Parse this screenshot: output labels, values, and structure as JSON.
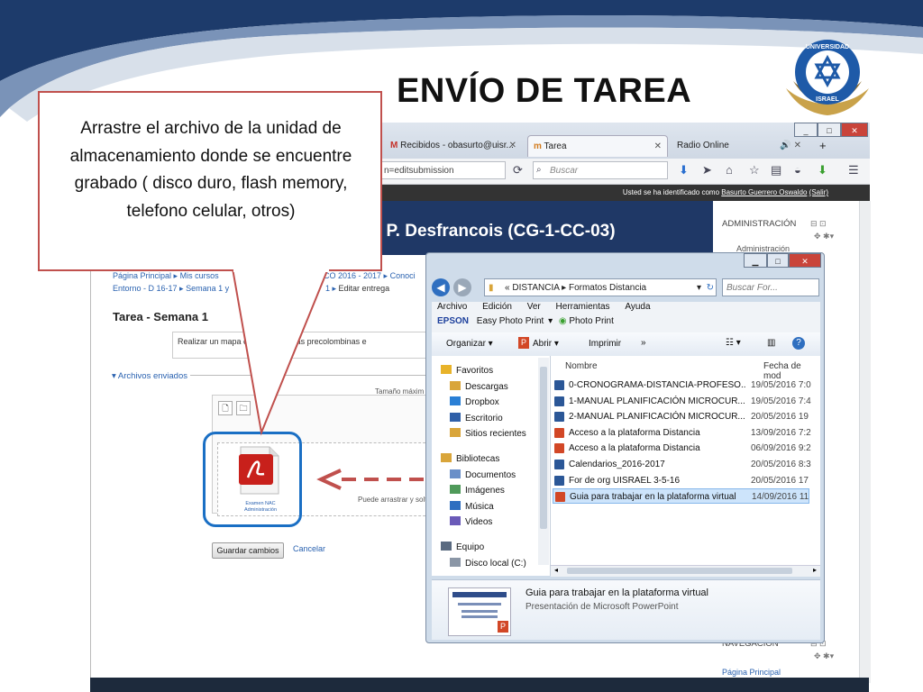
{
  "slide": {
    "title": "ENVÍO DE TAREA",
    "logo_text": "UNIVERSIDAD ISRAEL",
    "callout": "Arrastre el archivo de la unidad de almacenamiento donde se encuentre grabado ( disco duro, flash memory, telefono celular, otros)"
  },
  "browser": {
    "tabs": [
      {
        "label": "Recibidos - obasurto@uisr...",
        "icon": "gmail-icon"
      },
      {
        "label": "Tarea",
        "icon": "moodle-icon"
      },
      {
        "label": "Radio Online",
        "icon": "speaker-icon"
      }
    ],
    "new_tab": "+",
    "url": "n=editsubmission",
    "search_placeholder": "Buscar",
    "session_text": "Usted se ha identificado como",
    "user_link": "Basurto Guerrero Oswaldo",
    "logout": "(Salir)"
  },
  "moodle": {
    "course_title": "a - P. Desfrancois (CG-1-CC-03)",
    "breadcrumb": {
      "line1_a": "Página Principal",
      "line1_b": "Mis cursos",
      "line1_c": "CO 2016 - 2017",
      "line1_d": "Conoci",
      "line2_a": "Entorno - D 16-17",
      "line2_b": "Semana 1 y",
      "line2_c": "1",
      "line2_d": "Editar entrega"
    },
    "heading": "Tarea - Semana 1",
    "description": "Realizar un mapa c          bre las culturas precolombinas e",
    "files_legend": "Archivos enviados",
    "max_size": "Tamaño máxim",
    "dropzone_text": "Puede arrastrar y solt",
    "file_name": "Examen NAC Administración",
    "save_button": "Guardar cambios",
    "cancel": "Cancelar",
    "sidebar": {
      "admin_title": "ADMINISTRACIÓN",
      "admin_sub": "Administración",
      "nav_title": "NAVEGACIÓN",
      "nav_item": "Página Principal"
    }
  },
  "explorer": {
    "address_parts": [
      "«",
      "DISTANCIA",
      "Formatos Distancia"
    ],
    "search_placeholder": "Buscar For...",
    "menu": [
      "Archivo",
      "Edición",
      "Ver",
      "Herramientas",
      "Ayuda"
    ],
    "epson": {
      "brand": "EPSON",
      "easy": "Easy Photo Print",
      "photo": "Photo Print"
    },
    "toolbar": {
      "organize": "Organizar",
      "open": "Abrir",
      "print": "Imprimir",
      "more": "»"
    },
    "columns": {
      "name": "Nombre",
      "date": "Fecha de mod"
    },
    "nav": [
      {
        "label": "Favoritos",
        "icon": "star-icon",
        "top": true
      },
      {
        "label": "Descargas",
        "icon": "download-folder-icon"
      },
      {
        "label": "Dropbox",
        "icon": "dropbox-icon"
      },
      {
        "label": "Escritorio",
        "icon": "desktop-icon"
      },
      {
        "label": "Sitios recientes",
        "icon": "recent-icon"
      },
      {
        "label": "Bibliotecas",
        "icon": "library-icon",
        "top": true
      },
      {
        "label": "Documentos",
        "icon": "documents-icon"
      },
      {
        "label": "Imágenes",
        "icon": "images-icon"
      },
      {
        "label": "Música",
        "icon": "music-icon"
      },
      {
        "label": "Videos",
        "icon": "videos-icon"
      },
      {
        "label": "Equipo",
        "icon": "computer-icon",
        "top": true
      },
      {
        "label": "Disco local (C:)",
        "icon": "disk-icon"
      }
    ],
    "files": [
      {
        "name": "0-CRONOGRAMA-DISTANCIA-PROFESO...",
        "date": "19/05/2016 7:0",
        "type": "word"
      },
      {
        "name": "1-MANUAL PLANIFICACIÓN MICROCUR...",
        "date": "19/05/2016 7:4",
        "type": "word"
      },
      {
        "name": "2-MANUAL PLANIFICACIÓN MICROCUR...",
        "date": "20/05/2016 19",
        "type": "word"
      },
      {
        "name": "Acceso a la plataforma Distancia",
        "date": "13/09/2016 7:2",
        "type": "ppt"
      },
      {
        "name": "Acceso a la plataforma Distancia",
        "date": "06/09/2016 9:2",
        "type": "ppt"
      },
      {
        "name": "Calendarios_2016-2017",
        "date": "20/05/2016 8:3",
        "type": "word"
      },
      {
        "name": "For de org UISRAEL 3-5-16",
        "date": "20/05/2016 17",
        "type": "word"
      },
      {
        "name": "Guia para trabajar en la plataforma virtual",
        "date": "14/09/2016 11",
        "type": "ppt",
        "selected": true
      }
    ],
    "details": {
      "name": "Guia para trabajar en la plataforma virtual",
      "type": "Presentación de Microsoft PowerPoint"
    }
  },
  "colors": {
    "callout_border": "#c0504d",
    "arrow": "#c0504d",
    "highlight": "#1a6fc4",
    "banner": "#1f3866"
  }
}
